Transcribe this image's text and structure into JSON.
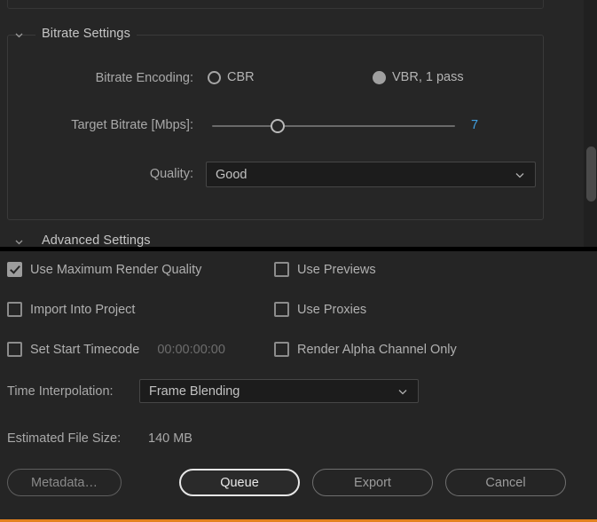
{
  "scroll_panel": {
    "groups": [
      {
        "title": "Bitrate Settings",
        "chevron_icon": "chevron-down-icon"
      },
      {
        "title": "Advanced Settings",
        "chevron_icon": "chevron-down-icon"
      }
    ],
    "bitrate": {
      "encoding_label": "Bitrate Encoding:",
      "options": [
        {
          "label": "CBR",
          "selected": false
        },
        {
          "label": "VBR, 1 pass",
          "selected": true
        }
      ],
      "target_bitrate_label": "Target Bitrate [Mbps]:",
      "target_bitrate_value": "7",
      "target_bitrate_percent": 27,
      "target_bitrate_color": "#3f9fe0",
      "quality_label": "Quality:",
      "quality_value": "Good",
      "quality_chevron_icon": "chevron-down-icon"
    },
    "scrollbar": {
      "name": "vertical-scrollbar"
    }
  },
  "bottom": {
    "checkboxes": [
      {
        "label": "Use Maximum Render Quality",
        "checked": true
      },
      {
        "label": "Use Previews",
        "checked": false
      },
      {
        "label": "Import Into Project",
        "checked": false
      },
      {
        "label": "Use Proxies",
        "checked": false
      },
      {
        "label": "Set Start Timecode",
        "checked": false,
        "extra": "00:00:00:00"
      },
      {
        "label": "Render Alpha Channel Only",
        "checked": false
      }
    ],
    "time_interpolation_label": "Time Interpolation:",
    "time_interpolation_value": "Frame Blending",
    "time_interpolation_chevron_icon": "chevron-down-icon",
    "estimated_file_size_label": "Estimated File Size:",
    "estimated_file_size_value": "140 MB",
    "buttons": [
      {
        "label": "Metadata…",
        "state": "dim"
      },
      {
        "label": "Queue",
        "state": "focused"
      },
      {
        "label": "Export",
        "state": "normal"
      },
      {
        "label": "Cancel",
        "state": "normal"
      }
    ],
    "accent_color": "#e3821f"
  }
}
